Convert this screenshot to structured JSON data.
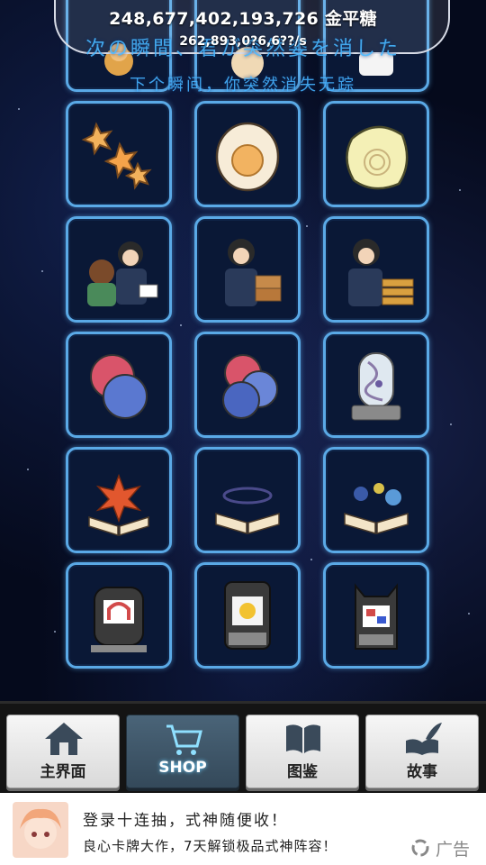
{
  "header": {
    "money": "248,677,402,193,726 金平糖",
    "rate": "262,893,0?6,6??/s"
  },
  "overlay": {
    "line1": "次の瞬間、君が突然姿を消した",
    "line2": "下个瞬间，你突然消失无踪"
  },
  "items": [
    {
      "icon": "kompeito-stars-icon"
    },
    {
      "icon": "boiled-egg-icon"
    },
    {
      "icon": "fish-cake-icon"
    },
    {
      "icon": "salesman-meeting-icon"
    },
    {
      "icon": "salesman-phone-boxes-icon"
    },
    {
      "icon": "salesman-gold-bars-icon"
    },
    {
      "icon": "red-blue-spheres-icon"
    },
    {
      "icon": "three-spheres-icon"
    },
    {
      "icon": "dna-capsule-icon"
    },
    {
      "icon": "exploding-book-icon"
    },
    {
      "icon": "ring-book-icon"
    },
    {
      "icon": "planets-book-icon"
    },
    {
      "icon": "robot-magnet-icon"
    },
    {
      "icon": "robot-sun-icon"
    },
    {
      "icon": "robot-cat-icon"
    }
  ],
  "nav": {
    "home": "主界面",
    "shop": "SHOP",
    "encyclopedia": "图鉴",
    "story": "故事"
  },
  "ad": {
    "line1": "登录十连抽，式神随便收！",
    "line2": "良心卡牌大作，7天解锁极品式神阵容！",
    "label": "广告"
  },
  "colors": {
    "tile_border": "#5aa9e6",
    "overlay_text": "#46b6ff",
    "active_tab": "#3d5568"
  }
}
